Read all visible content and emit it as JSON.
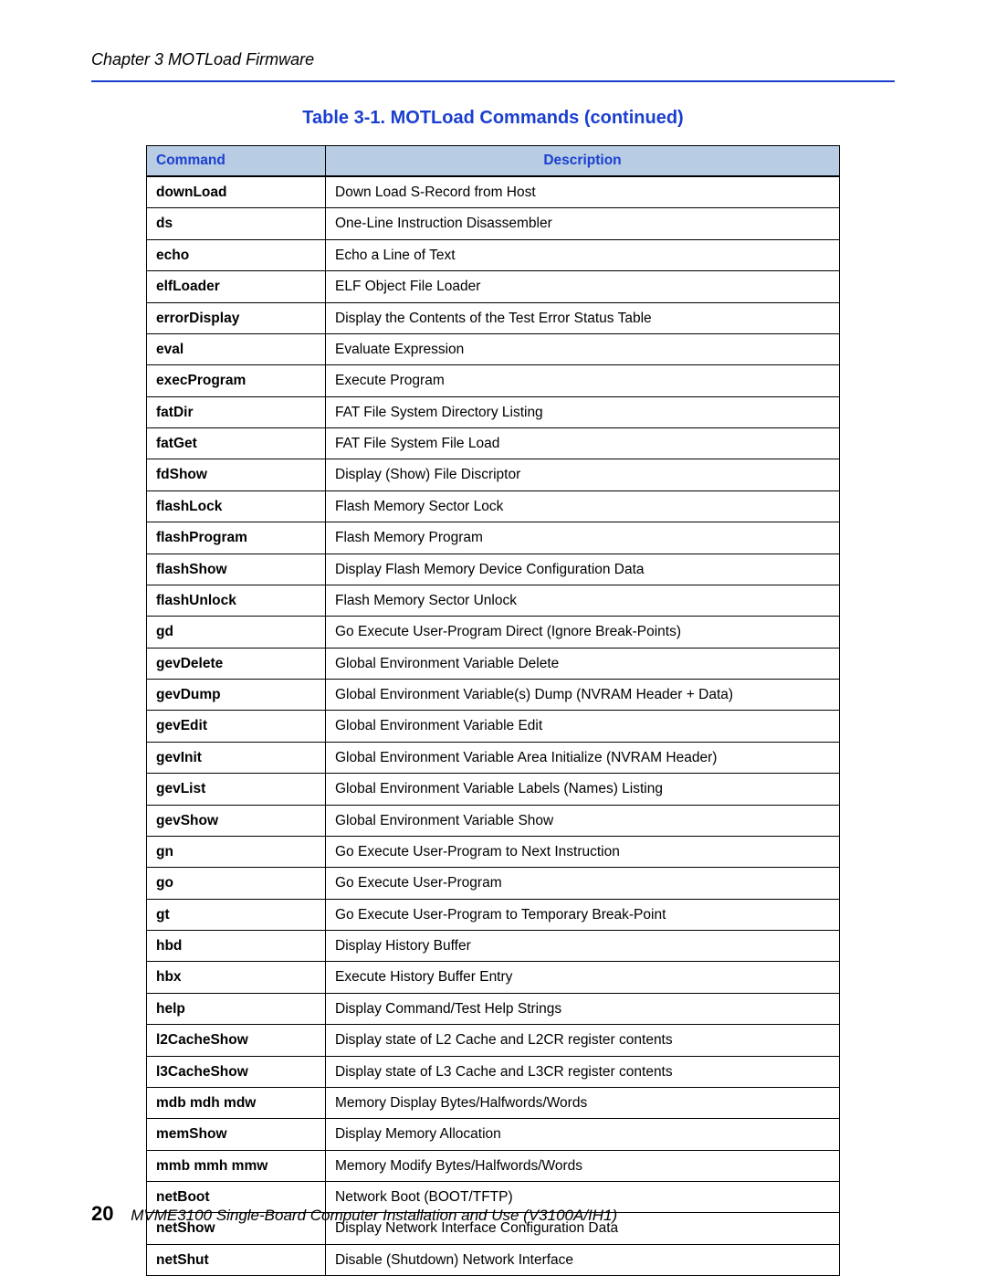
{
  "header": {
    "chapter": "Chapter 3  MOTLoad Firmware"
  },
  "table": {
    "title": "Table 3-1. MOTLoad Commands (continued)",
    "col_command": "Command",
    "col_description": "Description",
    "rows": [
      {
        "cmd": "downLoad",
        "desc": "Down Load S-Record from Host"
      },
      {
        "cmd": "ds",
        "desc": "One-Line Instruction Disassembler"
      },
      {
        "cmd": "echo",
        "desc": "Echo a Line of Text"
      },
      {
        "cmd": "elfLoader",
        "desc": "ELF Object File Loader"
      },
      {
        "cmd": "errorDisplay",
        "desc": "Display the Contents of the Test Error Status Table"
      },
      {
        "cmd": "eval",
        "desc": "Evaluate Expression"
      },
      {
        "cmd": "execProgram",
        "desc": "Execute Program"
      },
      {
        "cmd": "fatDir",
        "desc": "FAT File System Directory Listing"
      },
      {
        "cmd": "fatGet",
        "desc": "FAT File System File Load"
      },
      {
        "cmd": "fdShow",
        "desc": "Display (Show) File Discriptor"
      },
      {
        "cmd": "flashLock",
        "desc": "Flash Memory Sector Lock"
      },
      {
        "cmd": "flashProgram",
        "desc": "Flash Memory Program"
      },
      {
        "cmd": "flashShow",
        "desc": "Display Flash Memory Device Configuration Data"
      },
      {
        "cmd": "flashUnlock",
        "desc": "Flash Memory Sector Unlock"
      },
      {
        "cmd": "gd",
        "desc": "Go Execute User-Program Direct (Ignore Break-Points)"
      },
      {
        "cmd": "gevDelete",
        "desc": "Global Environment Variable Delete"
      },
      {
        "cmd": "gevDump",
        "desc": "Global Environment Variable(s) Dump (NVRAM Header + Data)"
      },
      {
        "cmd": "gevEdit",
        "desc": "Global Environment Variable Edit"
      },
      {
        "cmd": "gevInit",
        "desc": "Global Environment Variable Area Initialize (NVRAM Header)"
      },
      {
        "cmd": "gevList",
        "desc": "Global Environment Variable Labels (Names) Listing"
      },
      {
        "cmd": "gevShow",
        "desc": "Global Environment Variable Show"
      },
      {
        "cmd": "gn",
        "desc": "Go Execute User-Program to Next Instruction"
      },
      {
        "cmd": "go",
        "desc": "Go Execute User-Program"
      },
      {
        "cmd": "gt",
        "desc": "Go Execute User-Program to Temporary Break-Point"
      },
      {
        "cmd": "hbd",
        "desc": "Display History Buffer"
      },
      {
        "cmd": "hbx",
        "desc": "Execute History Buffer Entry"
      },
      {
        "cmd": "help",
        "desc": "Display Command/Test Help Strings"
      },
      {
        "cmd": "l2CacheShow",
        "desc": "Display state of L2 Cache and L2CR register contents"
      },
      {
        "cmd": "l3CacheShow",
        "desc": "Display state of L3 Cache and L3CR register contents"
      },
      {
        "cmd": "mdb mdh mdw",
        "desc": "Memory Display Bytes/Halfwords/Words"
      },
      {
        "cmd": "memShow",
        "desc": "Display Memory Allocation"
      },
      {
        "cmd": "mmb mmh mmw",
        "desc": "Memory Modify Bytes/Halfwords/Words"
      },
      {
        "cmd": "netBoot",
        "desc": "Network Boot (BOOT/TFTP)"
      },
      {
        "cmd": "netShow",
        "desc": "Display Network Interface Configuration Data"
      },
      {
        "cmd": "netShut",
        "desc": "Disable (Shutdown) Network Interface"
      }
    ]
  },
  "footer": {
    "page_number": "20",
    "doc_title": "MVME3100 Single-Board Computer Installation and Use (V3100A/IH1)"
  }
}
